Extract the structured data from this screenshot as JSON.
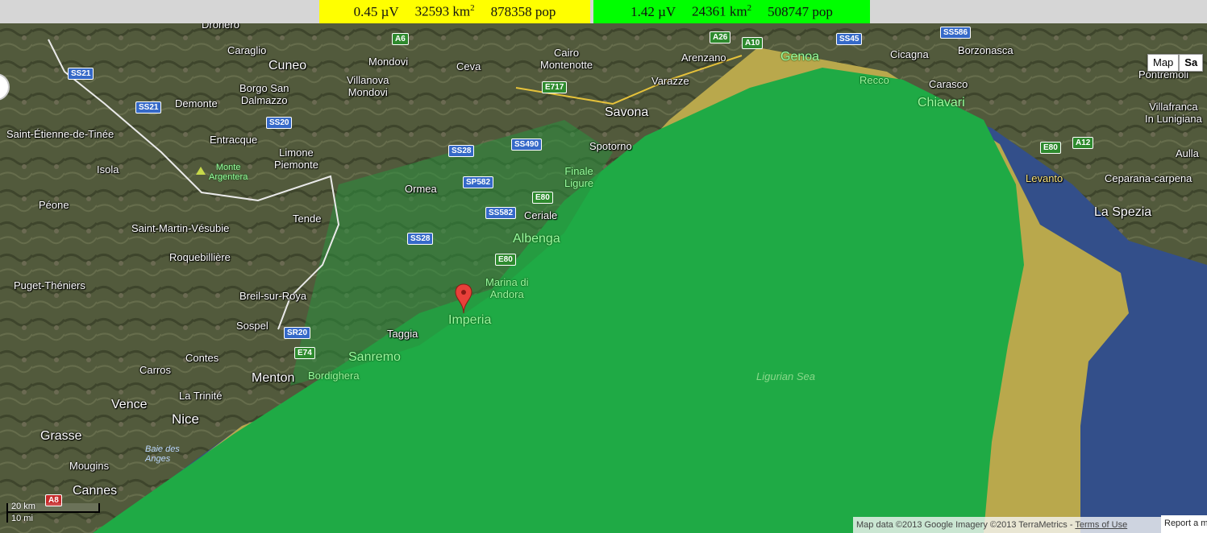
{
  "legend": {
    "yellow": {
      "signal": "0.45 µV",
      "area": "32593 km",
      "area_sup": "2",
      "pop": "878358 pop",
      "color": "#ffff00"
    },
    "green": {
      "signal": "1.42 µV",
      "area": "24361 km",
      "area_sup": "2",
      "pop": "508747 pop",
      "color": "#00ff00"
    }
  },
  "map_type": {
    "map": "Map",
    "satellite": "Sa"
  },
  "marker": {
    "icon": "map-pin-icon",
    "color": "#e8403a"
  },
  "places": [
    {
      "id": "dronero",
      "name": "Dronero"
    },
    {
      "id": "caraglio",
      "name": "Caraglio"
    },
    {
      "id": "cuneo",
      "name": "Cuneo"
    },
    {
      "id": "mondovi",
      "name": "Mondovi"
    },
    {
      "id": "ceva",
      "name": "Ceva"
    },
    {
      "id": "cairo",
      "name": "Cairo\nMontenotte"
    },
    {
      "id": "arenzano",
      "name": "Arenzano"
    },
    {
      "id": "genoa",
      "name": "Genoa"
    },
    {
      "id": "cicagna",
      "name": "Cicagna"
    },
    {
      "id": "borzonasca",
      "name": "Borzonasca"
    },
    {
      "id": "pontremoli",
      "name": "Pontremoli"
    },
    {
      "id": "villafranca",
      "name": "Villafranca\nIn Lunigiana"
    },
    {
      "id": "borgo",
      "name": "Borgo San\nDalmazzo"
    },
    {
      "id": "demonte",
      "name": "Demonte"
    },
    {
      "id": "villanova",
      "name": "Villanova\nMondovi"
    },
    {
      "id": "varazze",
      "name": "Varazze"
    },
    {
      "id": "recco",
      "name": "Recco"
    },
    {
      "id": "carasco",
      "name": "Carasco"
    },
    {
      "id": "chiavari",
      "name": "Chiavari"
    },
    {
      "id": "savona",
      "name": "Savona"
    },
    {
      "id": "sainte",
      "name": "Saint-Étienne-de-Tinée"
    },
    {
      "id": "entracque",
      "name": "Entracque"
    },
    {
      "id": "limone",
      "name": "Limone\nPiemonte"
    },
    {
      "id": "spotorno",
      "name": "Spotorno"
    },
    {
      "id": "aulla",
      "name": "Aulla"
    },
    {
      "id": "isola",
      "name": "Isola"
    },
    {
      "id": "argentera",
      "name": "Monte\nArgentera"
    },
    {
      "id": "finale",
      "name": "Finale\nLigure"
    },
    {
      "id": "levanto",
      "name": "Levanto"
    },
    {
      "id": "ceparana",
      "name": "Ceparana-carpena"
    },
    {
      "id": "ormea",
      "name": "Ormea"
    },
    {
      "id": "peone",
      "name": "Péone"
    },
    {
      "id": "ceriale",
      "name": "Ceriale"
    },
    {
      "id": "laspezia",
      "name": "La Spezia"
    },
    {
      "id": "tende",
      "name": "Tende"
    },
    {
      "id": "stmartin",
      "name": "Saint-Martin-Vésubie"
    },
    {
      "id": "albenga",
      "name": "Albenga"
    },
    {
      "id": "roquebilliere",
      "name": "Roquebillière"
    },
    {
      "id": "marina",
      "name": "Marina di\nAndora"
    },
    {
      "id": "puget",
      "name": "Puget-Théniers"
    },
    {
      "id": "breil",
      "name": "Breil-sur-Roya"
    },
    {
      "id": "imperia",
      "name": "Imperia"
    },
    {
      "id": "sospel",
      "name": "Sospel"
    },
    {
      "id": "taggia",
      "name": "Taggia"
    },
    {
      "id": "contes",
      "name": "Contes"
    },
    {
      "id": "sanremo",
      "name": "Sanremo"
    },
    {
      "id": "carros",
      "name": "Carros"
    },
    {
      "id": "bordighera",
      "name": "Bordighera"
    },
    {
      "id": "menton",
      "name": "Menton"
    },
    {
      "id": "ligurian",
      "name": "Ligurian Sea"
    },
    {
      "id": "latrinite",
      "name": "La Trinité"
    },
    {
      "id": "vence",
      "name": "Vence"
    },
    {
      "id": "nice",
      "name": "Nice"
    },
    {
      "id": "grasse",
      "name": "Grasse"
    },
    {
      "id": "baie",
      "name": "Baie des\nAnges"
    },
    {
      "id": "mougins",
      "name": "Mougins"
    },
    {
      "id": "cannes",
      "name": "Cannes"
    }
  ],
  "roads": [
    {
      "id": "a6",
      "name": "A6"
    },
    {
      "id": "a26",
      "name": "A26"
    },
    {
      "id": "a10",
      "name": "A10"
    },
    {
      "id": "ss45",
      "name": "SS45"
    },
    {
      "id": "ss586",
      "name": "SS586"
    },
    {
      "id": "ss21a",
      "name": "SS21"
    },
    {
      "id": "ss21b",
      "name": "SS21"
    },
    {
      "id": "e717",
      "name": "E717"
    },
    {
      "id": "ss20a",
      "name": "SS20"
    },
    {
      "id": "ss28a",
      "name": "SS28"
    },
    {
      "id": "ss490",
      "name": "SS490"
    },
    {
      "id": "e80a",
      "name": "E80"
    },
    {
      "id": "a12",
      "name": "A12"
    },
    {
      "id": "sp582",
      "name": "SP582"
    },
    {
      "id": "e80b",
      "name": "E80"
    },
    {
      "id": "ss582",
      "name": "SS582"
    },
    {
      "id": "ss28b",
      "name": "SS28"
    },
    {
      "id": "e80c",
      "name": "E80"
    },
    {
      "id": "sr20",
      "name": "SR20"
    },
    {
      "id": "e74",
      "name": "E74"
    },
    {
      "id": "a8",
      "name": "A8"
    }
  ],
  "scale": {
    "metric": "20 km",
    "imperial": "10 mi"
  },
  "attribution": {
    "text": "Map data ©2013 Google Imagery ©2013 TerraMetrics - ",
    "terms": "Terms of Use"
  },
  "report": {
    "label": "Report a m"
  }
}
